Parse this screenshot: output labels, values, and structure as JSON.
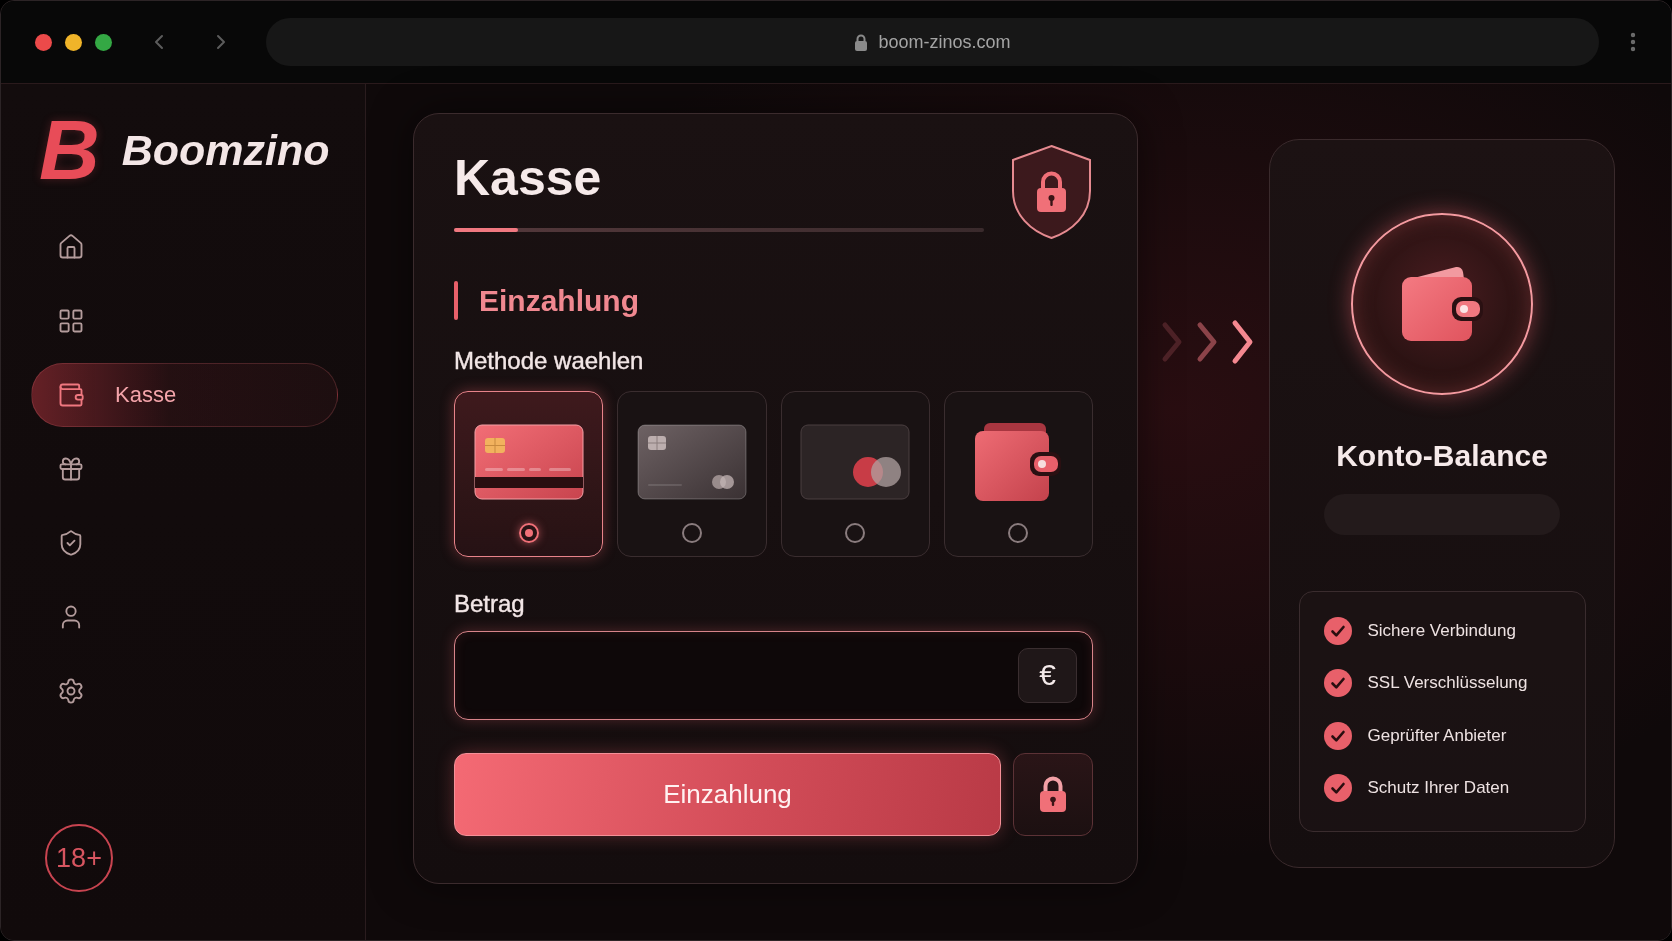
{
  "browser": {
    "url": "boom-zinos.com"
  },
  "sidebar": {
    "logo_mark": "B",
    "logo_text": "Boomzino",
    "items": [
      {
        "kind": "home",
        "selected": false
      },
      {
        "kind": "grid",
        "selected": false
      },
      {
        "kind": "wallet",
        "label": "Kasse",
        "selected": true
      },
      {
        "kind": "gift",
        "selected": false
      },
      {
        "kind": "shield",
        "selected": false
      },
      {
        "kind": "user",
        "selected": false
      },
      {
        "kind": "settings",
        "selected": false
      }
    ],
    "age_badge": "18+"
  },
  "checkout": {
    "title": "Kasse",
    "progress": {
      "level": 0.12
    },
    "section_title": "Einzahlung",
    "method_label": "Methode waehlen",
    "methods": [
      {
        "kind": "red_card",
        "selected": true
      },
      {
        "kind": "grey_card",
        "selected": false
      },
      {
        "kind": "circles_card",
        "selected": false
      },
      {
        "kind": "wallet",
        "selected": false
      }
    ],
    "amount": {
      "label": "Betrag",
      "currency": "€"
    },
    "submit_button": "Einzahlung"
  },
  "balance": {
    "title": "Konto-Balance",
    "features": [
      "Sichere Verbindung",
      "SSL Verschlüsselung",
      "Geprüfter Anbieter",
      "Schutz Ihrer Daten"
    ]
  }
}
